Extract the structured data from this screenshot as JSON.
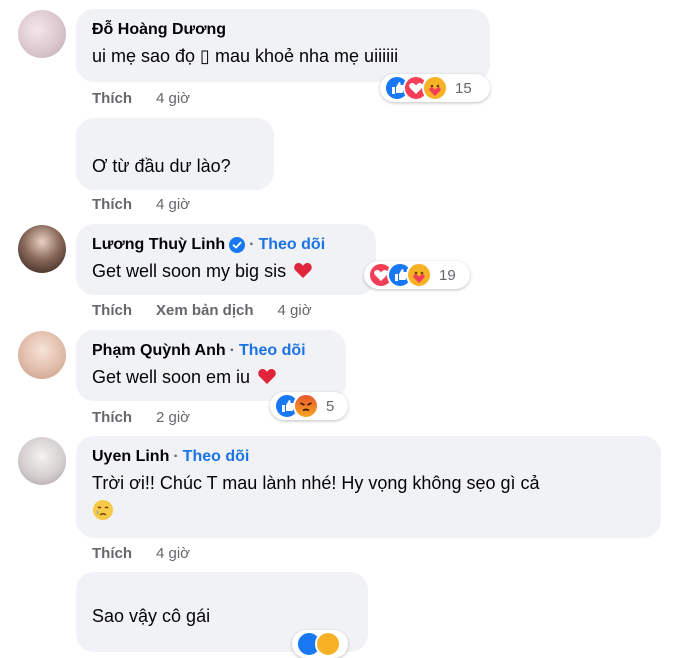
{
  "comments": [
    {
      "name": "Đỗ Hoàng Dương",
      "text": "ui mẹ sao đọ ▯ mau khoẻ nha mẹ uiiiiii",
      "like": "Thích",
      "time": "4 giờ",
      "reactions": [
        "like",
        "love",
        "care"
      ],
      "reaction_count": "15"
    },
    {
      "name": "",
      "text": "Ơ từ đầu dư lào?",
      "like": "Thích",
      "time": "4 giờ"
    },
    {
      "name": "Lương Thuỳ Linh",
      "verified": true,
      "follow": "Theo dõi",
      "text": "Get well soon my big sis",
      "like": "Thích",
      "translate": "Xem bản dịch",
      "time": "4 giờ",
      "reactions": [
        "love",
        "like",
        "care"
      ],
      "reaction_count": "19"
    },
    {
      "name": "Phạm Quỳnh Anh",
      "follow": "Theo dõi",
      "text": "Get well soon em iu",
      "like": "Thích",
      "time": "2 giờ",
      "reactions": [
        "like",
        "angry"
      ],
      "reaction_count": "5"
    },
    {
      "name": "Uyen Linh",
      "follow": "Theo dõi",
      "text": "Trời ơi!! Chúc T mau lành nhé! Hy vọng không sẹo gì cả",
      "like": "Thích",
      "time": "4 giờ"
    },
    {
      "name": "",
      "text": "Sao vậy cô gái"
    }
  ],
  "separator": "·",
  "colors": {
    "bubble": "#f0f2f5",
    "link": "#1b74e4",
    "meta": "#65676b",
    "like": "#1877f2",
    "love": "#f33e58",
    "care": "#f7b125"
  }
}
